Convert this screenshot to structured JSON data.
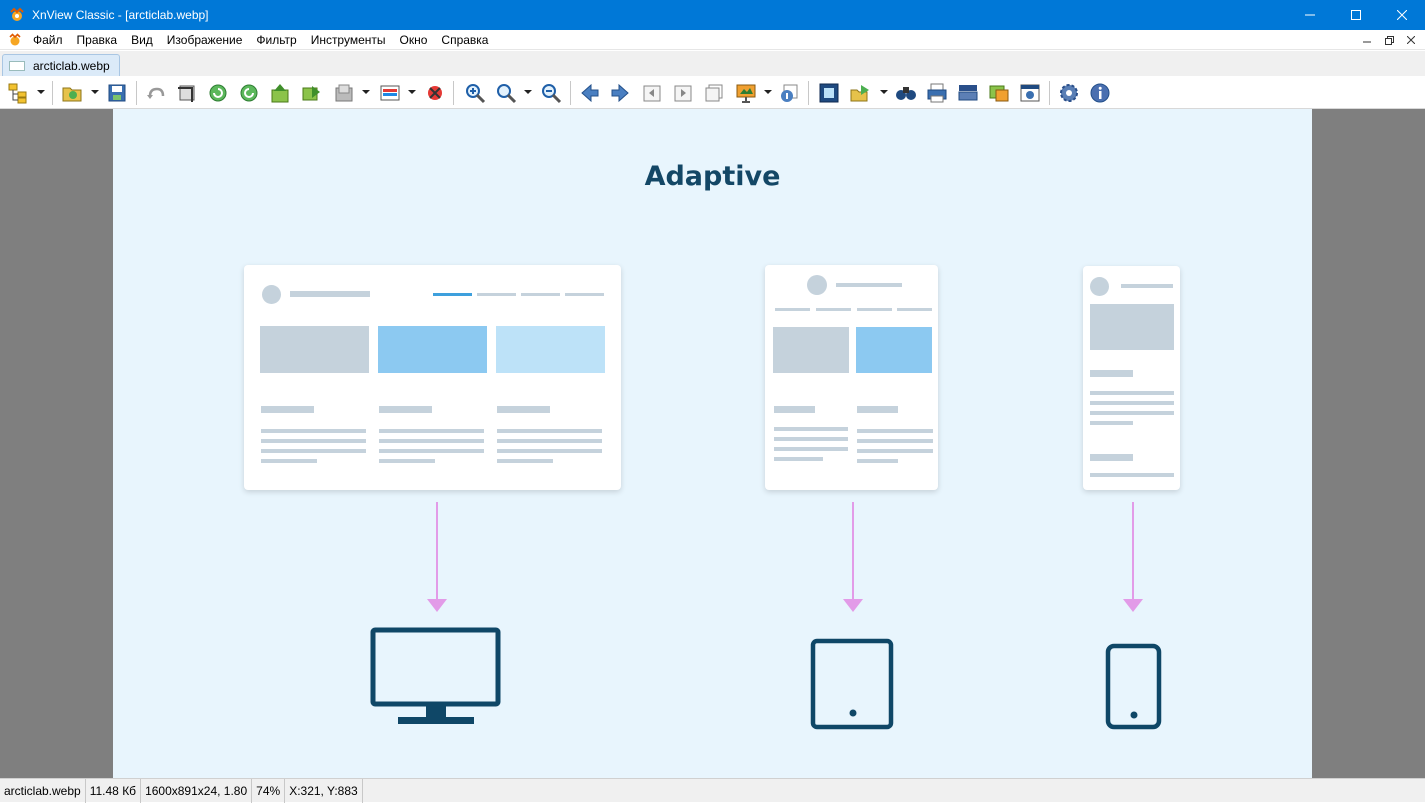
{
  "window": {
    "title": "XnView Classic - [arcticlab.webp]"
  },
  "menu": {
    "items": [
      "Файл",
      "Правка",
      "Вид",
      "Изображение",
      "Фильтр",
      "Инструменты",
      "Окно",
      "Справка"
    ]
  },
  "tabs": [
    {
      "label": "arcticlab.webp"
    }
  ],
  "toolbar": {
    "icons": [
      "browser-icon",
      "open-folder-icon",
      "save-icon",
      "undo-icon",
      "crop-icon",
      "rotate-left-icon",
      "rotate-right-icon",
      "move-up-icon",
      "move-forward-icon",
      "resize-icon",
      "color-adjust-icon",
      "red-eye-icon",
      "zoom-in-icon",
      "zoom-icon",
      "zoom-out-icon",
      "previous-icon",
      "next-icon",
      "first-page-icon",
      "next-page-icon",
      "multipage-icon",
      "slideshow-icon",
      "properties-icon",
      "fit-screen-icon",
      "export-icon",
      "find-icon",
      "print-icon",
      "scan-icon",
      "convert-icon",
      "capture-icon",
      "settings-icon",
      "info-icon"
    ]
  },
  "image": {
    "heading": "Adaptive",
    "colors": {
      "background": "#e8f5fd",
      "heading": "#134766",
      "arrow": "#e29be8",
      "device": "#0f4767",
      "accent_blue": "#8cc9f1",
      "light_blue": "#bde2f8",
      "gray_block": "#c5d2dc"
    }
  },
  "statusbar": {
    "filename": "arcticlab.webp",
    "filesize": "11.48 Кб",
    "dimensions": "1600x891x24, 1.80",
    "zoom": "74%",
    "cursor": "X:321, Y:883"
  }
}
